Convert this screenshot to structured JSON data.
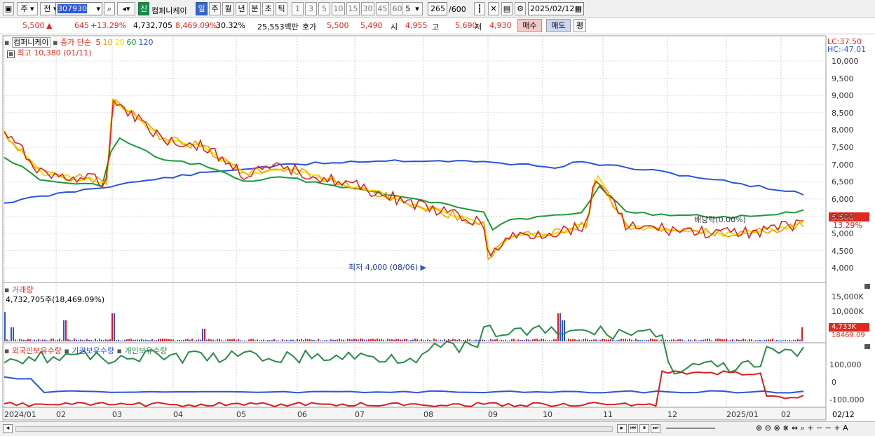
{
  "toolbar": {
    "period_main": "주",
    "period_label": "전",
    "code": "307930",
    "new_badge": "신",
    "stock_name": "컴퍼니케이",
    "periods": [
      "일",
      "주",
      "월",
      "년",
      "분",
      "초",
      "틱"
    ],
    "selected_period": "일",
    "numbers": [
      "1",
      "3",
      "5",
      "10",
      "15",
      "30",
      "45",
      "60"
    ],
    "count_select": "5",
    "bar_count": "265",
    "bar_total": "/600",
    "date": "2025/02/12"
  },
  "quote": {
    "price": "5,500",
    "arrow": "▲",
    "change": "645",
    "change_pct": "+13.29%",
    "volume": "4,732,705",
    "vol_ratio": "8,469.09%",
    "turnover": "30.32%",
    "amount": "25,553백만",
    "ask_label": "호가",
    "ask": "5,500",
    "bid": "5,490",
    "open_label": "시",
    "open": "4,955",
    "high_label": "고",
    "high": "5,690",
    "low_label": "저",
    "low": "4,930",
    "buy_button": "매수",
    "sell_button": "매도",
    "eval_button": "평"
  },
  "price_pane": {
    "title": "컴퍼니케이",
    "ma_label": "종가 단순",
    "ma_periods": [
      "5",
      "10",
      "20",
      "60",
      "120"
    ],
    "ma_colors": [
      "#d81e1e",
      "#f0a000",
      "#f0e000",
      "#1a9a3a",
      "#2a55d8"
    ],
    "high_note": "최고 10,380 (01/11)",
    "low_note": "최저 4,000 (08/06)",
    "dividend_note": "배당락(0.00%)",
    "lc": "LC:37.50",
    "hc": "HC:-47.01",
    "price_tag": "5,500",
    "pct_tag": "13.29%",
    "y_labels": [
      "10,000",
      "9,500",
      "9,000",
      "8,500",
      "8,000",
      "7,500",
      "7,000",
      "6,500",
      "6,000",
      "5,500",
      "5,000",
      "4,500",
      "4,000"
    ]
  },
  "volume_pane": {
    "title": "거래량",
    "value": "4,732,705주(18,469.09%)",
    "y_labels": [
      "15,000K",
      "10,000K"
    ],
    "tag1": "4,733K",
    "tag2": "18469.09"
  },
  "holdings_pane": {
    "series": [
      "외국인보유수량",
      "기관보유수량",
      "개인보유수량"
    ],
    "colors": [
      "#d81e1e",
      "#2a55d8",
      "#2a8a4a"
    ],
    "y_labels": [
      "100,000",
      "0",
      "-100,000"
    ]
  },
  "x_axis": {
    "labels": [
      "2024/01",
      "02",
      "03",
      "04",
      "05",
      "06",
      "07",
      "08",
      "09",
      "10",
      "11",
      "12",
      "2025/01",
      "02"
    ],
    "end_date": "02/12"
  }
}
